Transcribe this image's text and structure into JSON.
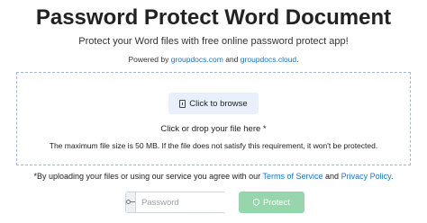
{
  "header": {
    "title": "Password Protect Word Document",
    "subtitle": "Protect your Word files with free online password protect app!",
    "powered_prefix": "Powered by",
    "powered_link1": "groupdocs.com",
    "powered_and": "and",
    "powered_link2": "groupdocs.cloud",
    "powered_suffix": "."
  },
  "upload": {
    "browse_label": "Click to browse",
    "drop_hint": "Click or drop your file here *",
    "size_note": "The maximum file size is 50 MB. If the file does not satisfy this requirement, it won't be protected."
  },
  "terms": {
    "prefix": "*By uploading your files or using our service you agree with our",
    "tos_link": "Terms of Service",
    "and": "and",
    "privacy_link": "Privacy Policy",
    "suffix": "."
  },
  "form": {
    "password_placeholder": "Password",
    "password_value": "",
    "protect_label": "Protect"
  },
  "colors": {
    "link": "#1a73c9",
    "protect_button": "#97d6ad",
    "browse_button": "#e8f1fb",
    "dropzone_border": "#9fbad8"
  },
  "icons": {
    "browse": "file-icon",
    "password": "key-icon",
    "protect": "shield-icon"
  }
}
